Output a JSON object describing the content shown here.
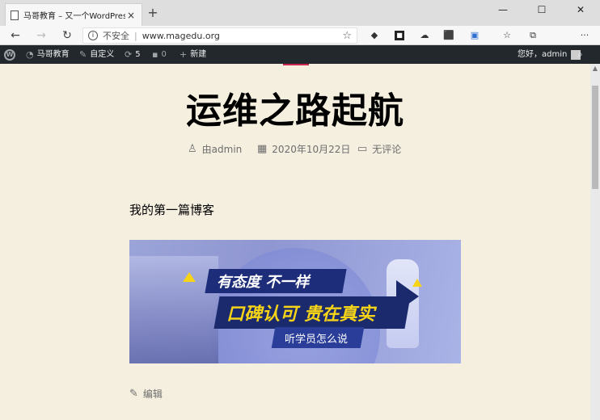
{
  "browser": {
    "tab_title": "马哥教育 – 又一个WordPress站点",
    "tab_close": "×",
    "new_tab": "+",
    "window_controls": [
      "—",
      "☐",
      "✕"
    ],
    "back": "←",
    "forward": "→",
    "refresh": "↻",
    "security_label": "不安全",
    "separator": "|",
    "url": "www.magedu.org",
    "favorite": "☆",
    "more": "···"
  },
  "wp_admin_bar": {
    "site_name": "马哥教育",
    "customize": "自定义",
    "updates_count": "5",
    "comments_count": "0",
    "new_label": "新建",
    "greeting": "您好，admin",
    "search": "⌕"
  },
  "post": {
    "title": "运维之路起航",
    "author": "由admin",
    "date": "2020年10月22日",
    "comments": "无评论",
    "body": "我的第一篇博客",
    "edit": "编辑"
  },
  "banner": {
    "line1": "有态度 不一样",
    "line2": "口碑认可 贵在真实",
    "line3": "听学员怎么说"
  },
  "colors": {
    "page_bg": "#f5efe0",
    "admin_bar": "#23282d",
    "accent": "#cd2653"
  }
}
